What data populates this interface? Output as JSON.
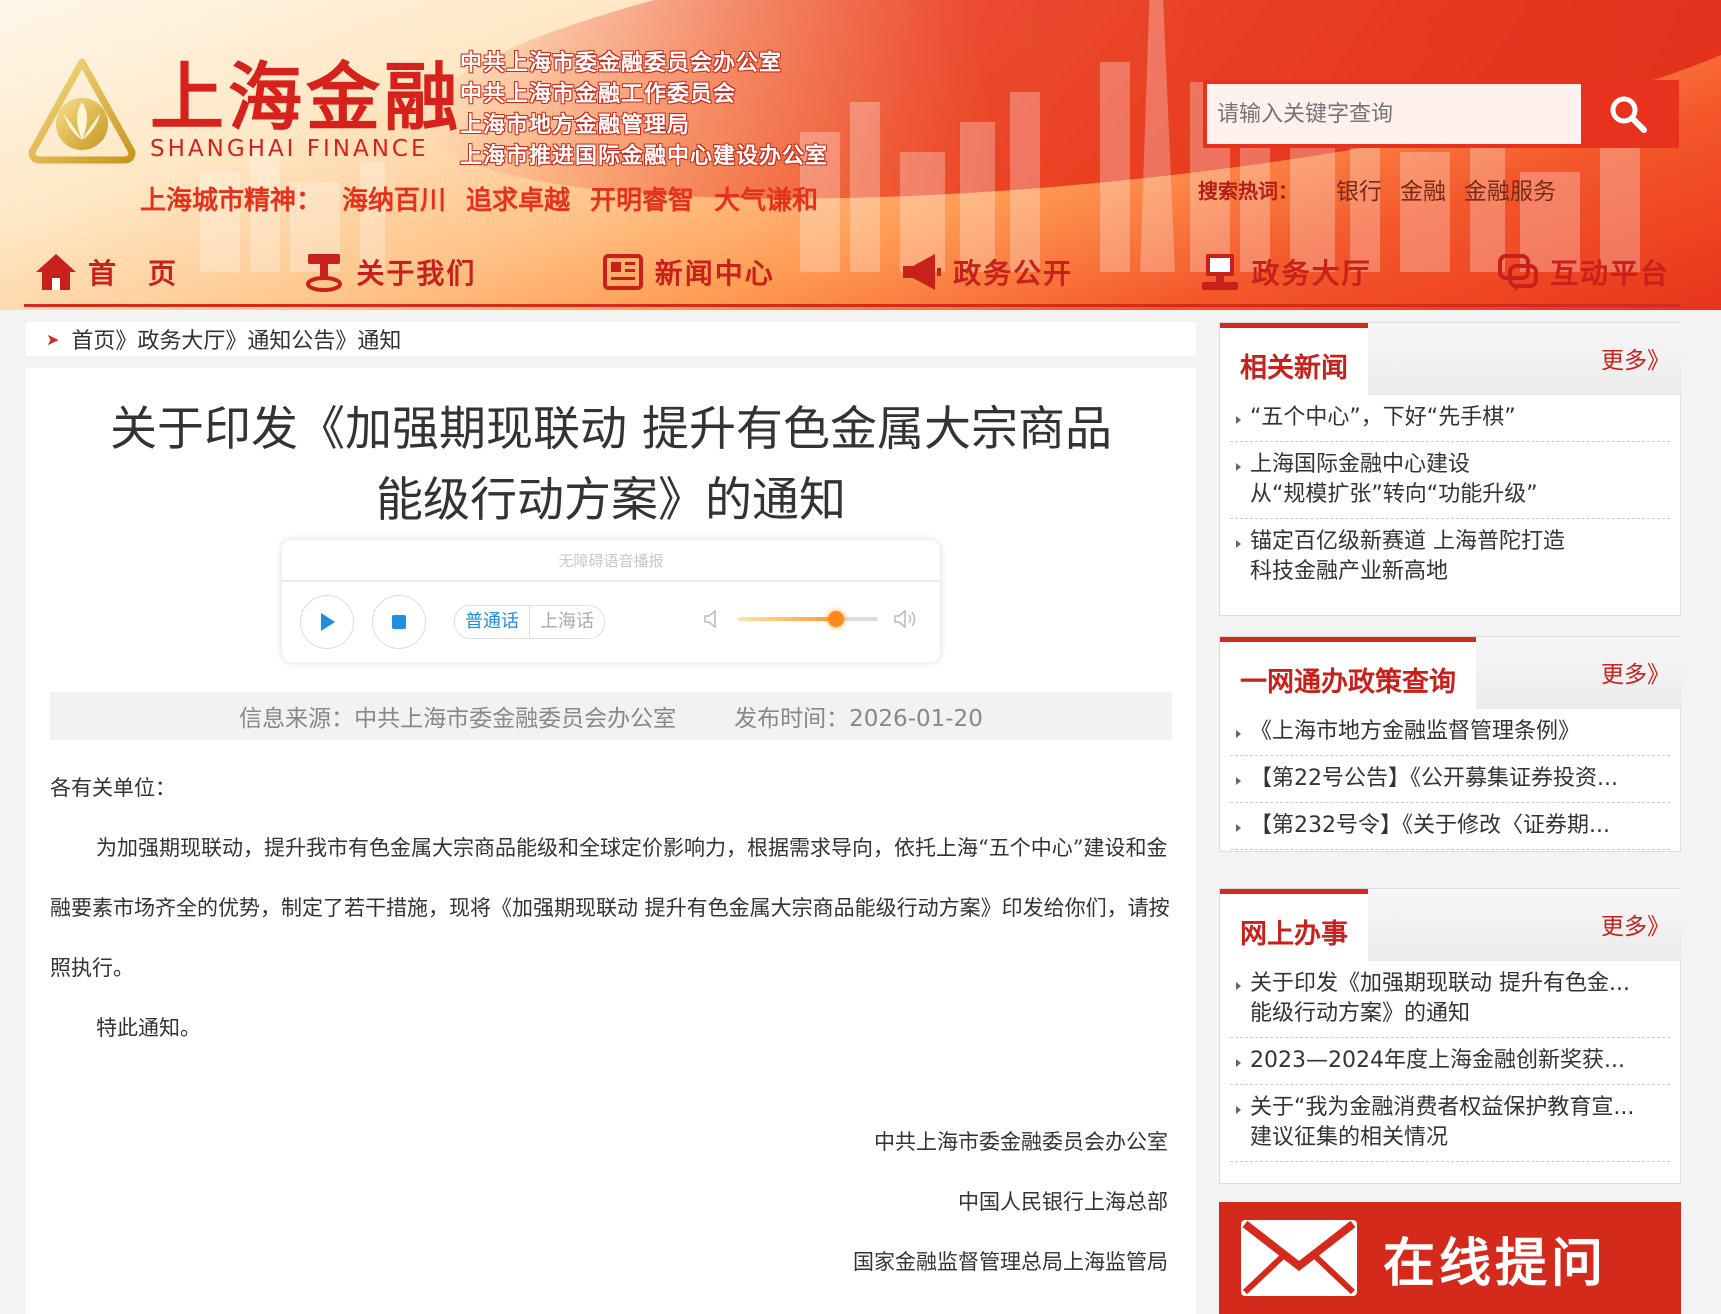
{
  "brand": {
    "cn": "上海金融",
    "en": "SHANGHAI FINANCE",
    "orgs": [
      "中共上海市委金融委员会办公室",
      "中共上海市金融工作委员会",
      "上海市地方金融管理局",
      "上海市推进国际金融中心建设办公室"
    ],
    "spirit": [
      "上海城市精神：",
      "海纳百川",
      "追求卓越",
      "开明睿智",
      "大气谦和"
    ],
    "color": "#d7211c"
  },
  "search": {
    "placeholder": "请输入关键字查询",
    "hot_label": "搜索热词：",
    "hot_words": [
      "银行",
      "金融",
      "金融服务"
    ]
  },
  "nav": [
    {
      "label": "首　页",
      "icon": "home-icon"
    },
    {
      "label": "关于我们",
      "icon": "about-icon"
    },
    {
      "label": "新闻中心",
      "icon": "news-icon"
    },
    {
      "label": "政务公开",
      "icon": "megaphone-icon"
    },
    {
      "label": "政务大厅",
      "icon": "hall-icon"
    },
    {
      "label": "互动平台",
      "icon": "chat-icon"
    }
  ],
  "breadcrumb": "首页》政务大厅》通知公告》通知",
  "article": {
    "title_line1": "关于印发《加强期现联动 提升有色金属大宗商品",
    "title_line2": "能级行动方案》的通知",
    "player": {
      "label": "无障碍语音播报",
      "lang_on": "普通话",
      "lang_off": "上海话",
      "volume": 0.7
    },
    "source": "信息来源：中共上海市委金融委员会办公室",
    "date": "发布时间：2026-01-20",
    "salutation": "各有关单位：",
    "para1": "为加强期现联动，提升我市有色金属大宗商品能级和全球定价影响力，根据需求导向，依托上海“五个中心”建设和金融要素市场齐全的优势，制定了若干措施，现将《加强期现联动 提升有色金属大宗商品能级行动方案》印发给你们，请按照执行。",
    "para2": "特此通知。",
    "signers": [
      "中共上海市委金融委员会办公室",
      "中国人民银行上海总部",
      "国家金融监督管理总局上海监管局"
    ]
  },
  "sidebar": {
    "more_label": "更多》",
    "related": {
      "title": "相关新闻",
      "items": [
        [
          "“五个中心”，下好“先手棋”"
        ],
        [
          "上海国际金融中心建设",
          "从“规模扩张”转向“功能升级”"
        ],
        [
          "锚定百亿级新赛道 上海普陀打造",
          "科技金融产业新高地"
        ]
      ]
    },
    "policy": {
      "title": "一网通办政策查询",
      "items": [
        [
          "《上海市地方金融监督管理条例》"
        ],
        [
          "【第22号公告】《公开募集证券投资..."
        ],
        [
          "【第232号令】《关于修改〈证券期..."
        ]
      ]
    },
    "online": {
      "title": "网上办事",
      "items": [
        [
          "关于印发《加强期现联动 提升有色金...",
          "能级行动方案》的通知"
        ],
        [
          "2023—2024年度上海金融创新奖获..."
        ],
        [
          "关于“我为金融消费者权益保护教育宣...",
          "建议征集的相关情况"
        ]
      ]
    },
    "ask": "在线提问"
  }
}
